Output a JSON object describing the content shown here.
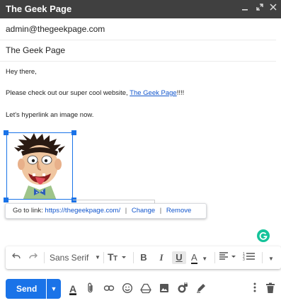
{
  "window": {
    "title": "The Geek Page",
    "controls": [
      "minimize-icon",
      "expand-icon",
      "close-icon"
    ]
  },
  "fields": {
    "to": "admin@thegeekpage.com",
    "subject": "The Geek Page"
  },
  "body": {
    "greeting": "Hey there,",
    "line1_before": "Please check out our super cool website, ",
    "line1_link": "The Geek Page",
    "line1_after": "!!!!",
    "line2": "Let's hyperlink an image now."
  },
  "link_bubble": {
    "prefix": "Go to link:",
    "url": "https://thegeekpage.com/",
    "change": "Change",
    "remove": "Remove",
    "separator": "|"
  },
  "format_toolbar": {
    "font": "Sans Serif",
    "icons": [
      "undo-icon",
      "redo-icon",
      "font-dropdown",
      "text-size-icon",
      "bold-icon",
      "italic-icon",
      "underline-icon",
      "text-color-icon",
      "align-icon",
      "numbered-list-icon",
      "more-formatting-icon"
    ],
    "bold": "B",
    "italic": "I",
    "underline": "U",
    "text_color": "A"
  },
  "bottom_bar": {
    "send": "Send",
    "icons": [
      "formatting-toggle-icon",
      "attach-icon",
      "insert-link-icon",
      "emoji-icon",
      "drive-icon",
      "insert-photo-icon",
      "confidential-mode-icon",
      "signature-icon",
      "more-options-icon",
      "discard-icon"
    ],
    "format_letter": "A"
  },
  "colors": {
    "titlebar": "#404040",
    "accent_blue": "#1a73e8",
    "link": "#1155cc",
    "grammarly": "#15c39a"
  }
}
